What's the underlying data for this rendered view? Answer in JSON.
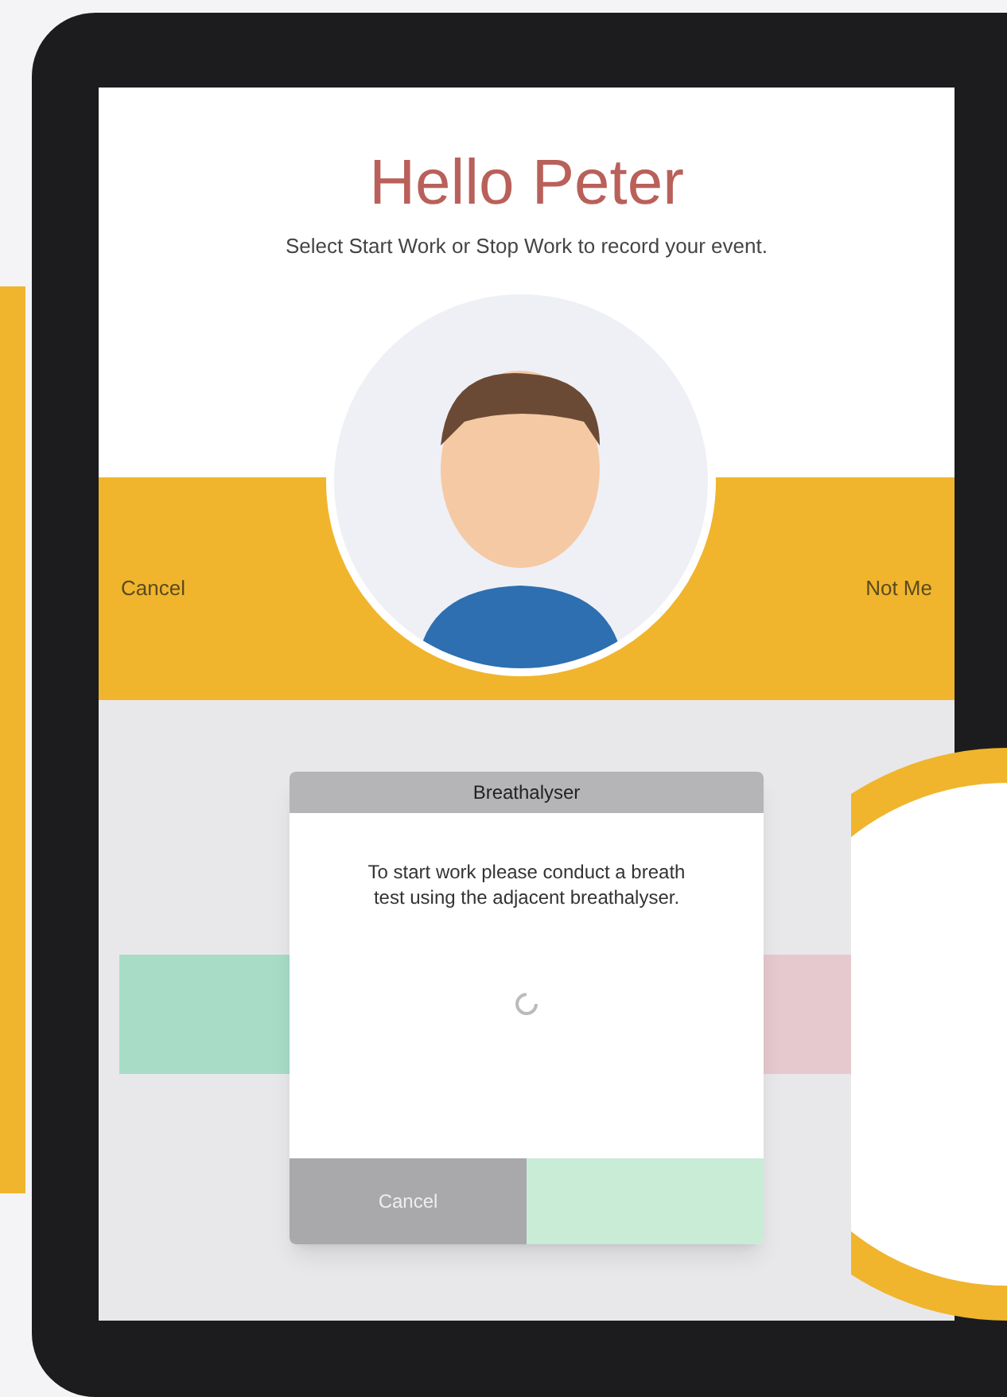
{
  "greeting": {
    "title": "Hello Peter",
    "subtitle": "Select Start Work or Stop Work to record your event."
  },
  "band": {
    "left_action": "Cancel",
    "right_action": "Not Me"
  },
  "background_buttons": [
    {
      "color": "#a8dcc6"
    },
    {
      "color": "#e6c9cf"
    }
  ],
  "dialog": {
    "title": "Breathalyser",
    "message": "To start work please conduct a breath test using the adjacent breathalyser.",
    "buttons": [
      {
        "kind": "cancel",
        "label": "Cancel"
      },
      {
        "kind": "confirm"
      }
    ]
  }
}
